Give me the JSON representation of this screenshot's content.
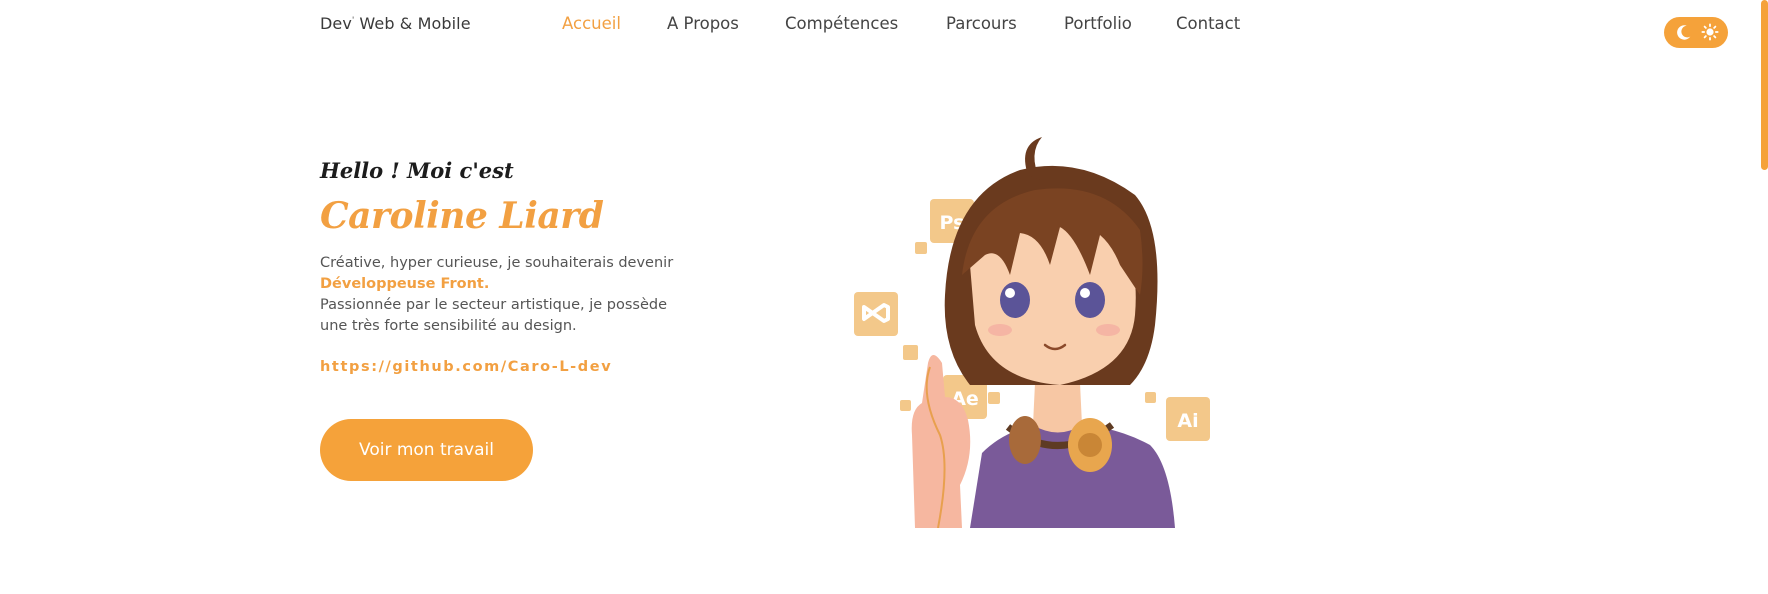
{
  "header": {
    "brand": "Dev",
    "brand_mark": "'",
    "brand_rest": " Web & Mobile",
    "nav": [
      {
        "label": "Accueil",
        "active": true
      },
      {
        "label": "A Propos",
        "active": false
      },
      {
        "label": "Compétences",
        "active": false
      },
      {
        "label": "Parcours",
        "active": false
      },
      {
        "label": "Portfolio",
        "active": false
      },
      {
        "label": "Contact",
        "active": false
      }
    ],
    "theme_toggle": {
      "left_icon": "moon-icon",
      "right_icon": "sun-icon",
      "color": "#f5a23a"
    }
  },
  "hero": {
    "greeting": "Hello ! Moi c'est",
    "name": "Caroline Liard",
    "description_line1": "Créative, hyper curieuse, je souhaiterais devenir",
    "description_highlight": "Développeuse Front.",
    "description_line2": "Passionnée par le secteur artistique, je possède une très forte sensibilité au design.",
    "github_link": "https://github.com/Caro-L-dev",
    "cta_label": "Voir mon travail"
  },
  "illustration": {
    "badges": [
      "Ps",
      "Ae",
      "Ai"
    ],
    "vscode_icon": "vscode-icon"
  },
  "colors": {
    "accent": "#f2a042",
    "text": "#444444",
    "heading": "#1c1c1c"
  }
}
